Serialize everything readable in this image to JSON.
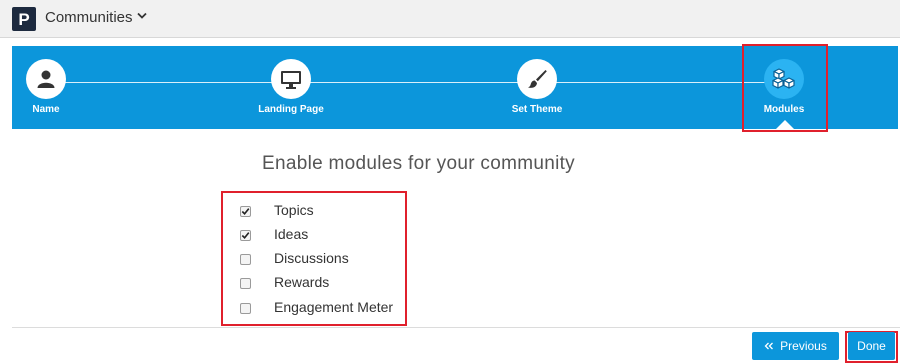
{
  "header": {
    "logo_letter": "P",
    "app_title": "Communities"
  },
  "steps": [
    {
      "label": "Name",
      "icon": "user-icon"
    },
    {
      "label": "Landing Page",
      "icon": "monitor-icon"
    },
    {
      "label": "Set Theme",
      "icon": "paintbrush-icon"
    },
    {
      "label": "Modules",
      "icon": "cubes-icon",
      "active": true
    }
  ],
  "main": {
    "heading": "Enable modules for your community",
    "modules": [
      {
        "label": "Topics",
        "checked": true
      },
      {
        "label": "Ideas",
        "checked": true
      },
      {
        "label": "Discussions",
        "checked": false
      },
      {
        "label": "Rewards",
        "checked": false
      },
      {
        "label": "Engagement Meter",
        "checked": false
      }
    ]
  },
  "footer": {
    "previous_label": "Previous",
    "previous_icon": "double-chevron-left-icon",
    "done_label": "Done"
  },
  "colors": {
    "brand_blue": "#0c96db",
    "highlight_red": "#e0202c",
    "logo_navy": "#1d2a3f"
  }
}
